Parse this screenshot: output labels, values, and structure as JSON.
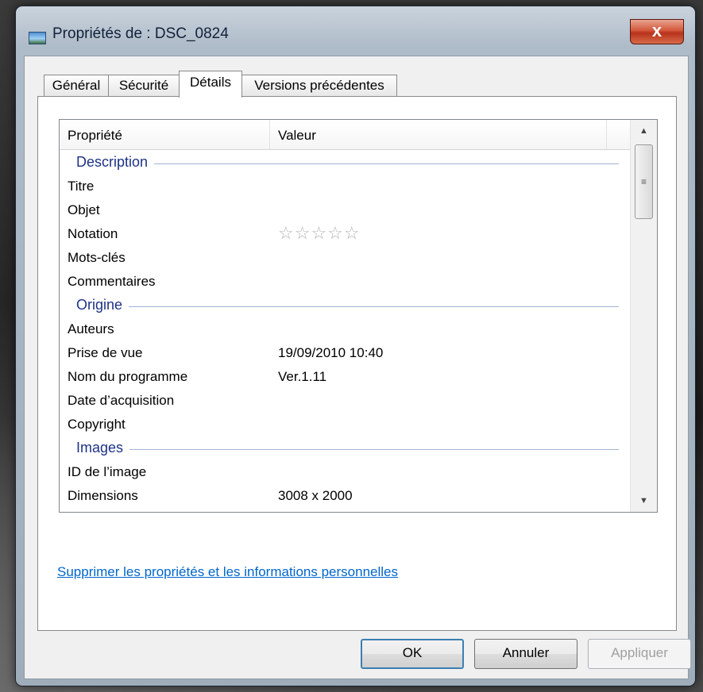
{
  "window": {
    "title": "Propriétés de : DSC_0824",
    "close_glyph": "x"
  },
  "tabs": [
    {
      "label": "Général"
    },
    {
      "label": "Sécurité"
    },
    {
      "label": "Détails"
    },
    {
      "label": "Versions précédentes"
    }
  ],
  "list": {
    "col_property": "Propriété",
    "col_value": "Valeur",
    "groups": {
      "description": "Description",
      "origine": "Origine",
      "images": "Images"
    },
    "rows": {
      "titre": {
        "name": "Titre",
        "value": ""
      },
      "objet": {
        "name": "Objet",
        "value": ""
      },
      "notation": {
        "name": "Notation",
        "stars": "☆☆☆☆☆",
        "rating": 0,
        "max_rating": 5
      },
      "mots_cles": {
        "name": "Mots-clés",
        "value": ""
      },
      "commentaires": {
        "name": "Commentaires",
        "value": ""
      },
      "auteurs": {
        "name": "Auteurs",
        "value": ""
      },
      "prise_de_vue": {
        "name": "Prise de vue",
        "value": "19/09/2010 10:40"
      },
      "nom_programme": {
        "name": "Nom du programme",
        "value": "Ver.1.11"
      },
      "date_acquisition": {
        "name": "Date d’acquisition",
        "value": ""
      },
      "copyright": {
        "name": "Copyright",
        "value": ""
      },
      "id_image": {
        "name": "ID de l’image",
        "value": ""
      },
      "dimensions": {
        "name": "Dimensions",
        "value": "3008 x 2000"
      }
    }
  },
  "scrollbar": {
    "up": "▲",
    "down": "▼",
    "thumb_grip": "≡"
  },
  "link": {
    "label": "Supprimer les propriétés et les informations personnelles"
  },
  "buttons": {
    "ok": "OK",
    "cancel": "Annuler",
    "apply": "Appliquer"
  },
  "colors": {
    "link": "#0066cc",
    "group_header": "#1e3287",
    "close_button": "#c8452b"
  }
}
